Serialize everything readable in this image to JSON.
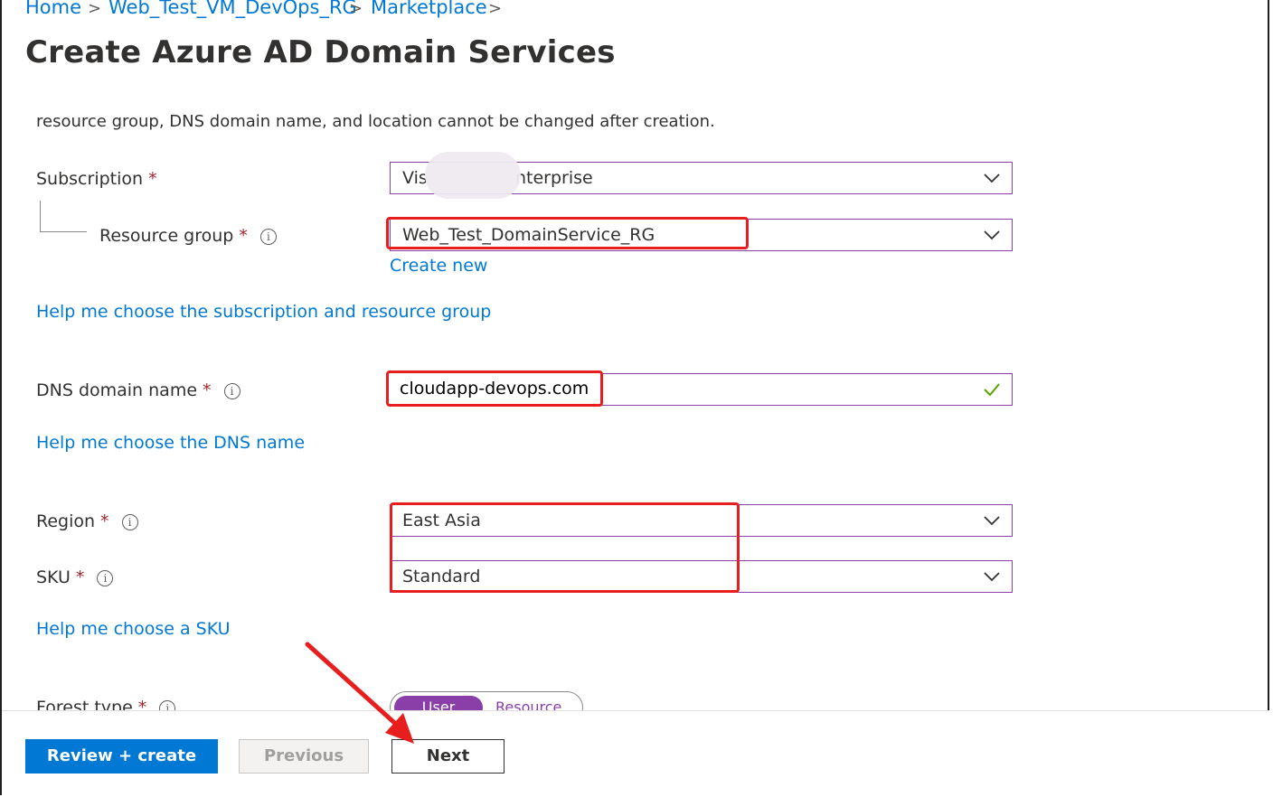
{
  "breadcrumb": {
    "items": [
      "Home",
      "Web_Test_VM_DevOps_RG",
      "Marketplace"
    ],
    "separator": ">"
  },
  "page": {
    "title": "Create Azure AD Domain Services",
    "more_label": "···",
    "description": "resource group, DNS domain name, and location cannot be changed after creation."
  },
  "form": {
    "subscription": {
      "label": "Subscription",
      "required": "*",
      "value_start": "Vis",
      "value_end": "nterprise"
    },
    "resource_group": {
      "label": "Resource group",
      "required": "*",
      "value": "Web_Test_DomainService_RG",
      "create_new": "Create new"
    },
    "help_subscription": "Help me choose the subscription and resource group",
    "dns": {
      "label": "DNS domain name",
      "required": "*",
      "value": "cloudapp-devops.com",
      "valid_icon": "checkmark-icon"
    },
    "help_dns": "Help me choose the DNS name",
    "region": {
      "label": "Region",
      "required": "*",
      "value": "East Asia"
    },
    "sku": {
      "label": "SKU",
      "required": "*",
      "value": "Standard"
    },
    "help_sku": "Help me choose a SKU",
    "forest_type": {
      "label": "Forest type",
      "required": "*",
      "options": [
        "User",
        "Resource"
      ],
      "selected": "User"
    },
    "info_glyph": "i"
  },
  "footer": {
    "review_create": "Review + create",
    "previous": "Previous",
    "next": "Next"
  },
  "colors": {
    "accent": "#0078d4",
    "field_border": "#8a3fa8",
    "annotation_red": "#e81d1d",
    "valid_green": "#57a300"
  }
}
